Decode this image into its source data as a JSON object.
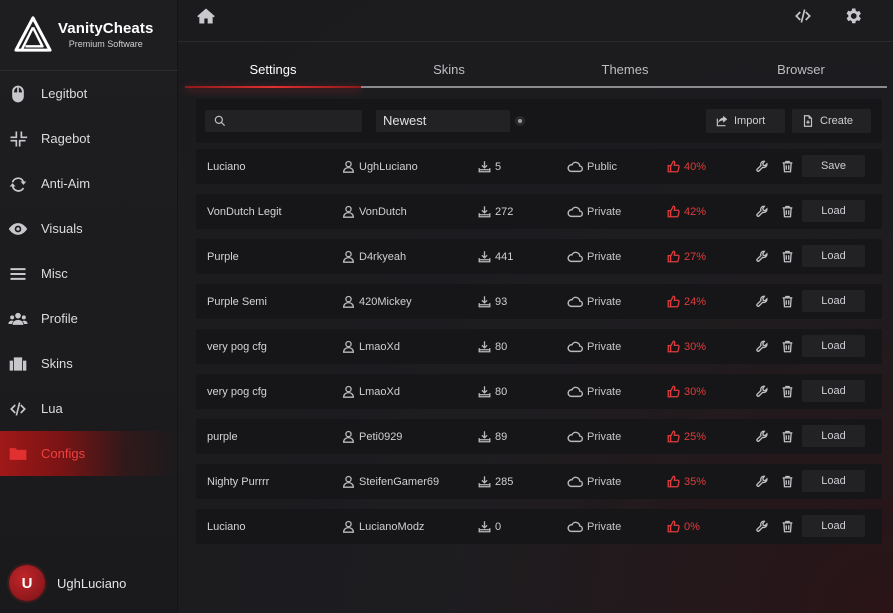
{
  "brand": {
    "name": "VanityCheats",
    "tagline": "Premium Software"
  },
  "sidebar": {
    "items": [
      {
        "label": "Legitbot",
        "icon": "mouse-icon"
      },
      {
        "label": "Ragebot",
        "icon": "compress-icon"
      },
      {
        "label": "Anti-Aim",
        "icon": "sync-icon"
      },
      {
        "label": "Visuals",
        "icon": "eye-icon"
      },
      {
        "label": "Misc",
        "icon": "bars-icon"
      },
      {
        "label": "Profile",
        "icon": "users-icon"
      },
      {
        "label": "Skins",
        "icon": "wardrobe-icon"
      },
      {
        "label": "Lua",
        "icon": "code-icon"
      },
      {
        "label": "Configs",
        "icon": "folder-icon",
        "active": true
      }
    ]
  },
  "user": {
    "initial": "U",
    "name": "UghLuciano"
  },
  "tabs": [
    {
      "label": "Settings",
      "active": true
    },
    {
      "label": "Skins"
    },
    {
      "label": "Themes"
    },
    {
      "label": "Browser"
    }
  ],
  "filters": {
    "search_value": "",
    "search_placeholder": "",
    "sort_value": "Newest",
    "import_label": "Import",
    "create_label": "Create"
  },
  "configs": [
    {
      "name": "Luciano",
      "author": "UghLuciano",
      "downloads": "5",
      "visibility": "Public",
      "rating": "40%",
      "action": "Save"
    },
    {
      "name": "VonDutch Legit",
      "author": "VonDutch",
      "downloads": "272",
      "visibility": "Private",
      "rating": "42%",
      "action": "Load"
    },
    {
      "name": "Purple",
      "author": "D4rkyeah",
      "downloads": "441",
      "visibility": "Private",
      "rating": "27%",
      "action": "Load"
    },
    {
      "name": "Purple Semi",
      "author": "420Mickey",
      "downloads": "93",
      "visibility": "Private",
      "rating": "24%",
      "action": "Load"
    },
    {
      "name": "very pog cfg",
      "author": "LmaoXd",
      "downloads": "80",
      "visibility": "Private",
      "rating": "30%",
      "action": "Load"
    },
    {
      "name": "very pog cfg",
      "author": "LmaoXd",
      "downloads": "80",
      "visibility": "Private",
      "rating": "30%",
      "action": "Load"
    },
    {
      "name": "purple",
      "author": "Peti0929",
      "downloads": "89",
      "visibility": "Private",
      "rating": "25%",
      "action": "Load"
    },
    {
      "name": "Nighty Purrrr",
      "author": "SteifenGamer69",
      "downloads": "285",
      "visibility": "Private",
      "rating": "35%",
      "action": "Load"
    },
    {
      "name": "Luciano",
      "author": "LucianoModz",
      "downloads": "0",
      "visibility": "Private",
      "rating": "0%",
      "action": "Load"
    }
  ],
  "colors": {
    "accent": "#e03030",
    "background": "#1b1b1e",
    "panel": "#161618",
    "control": "#222225"
  }
}
